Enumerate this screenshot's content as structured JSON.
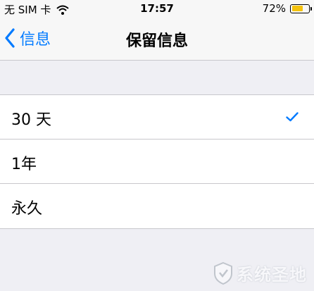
{
  "status_bar": {
    "carrier": "无 SIM 卡",
    "time": "17:57",
    "battery_percent": "72%",
    "battery_level": 0.72,
    "battery_color": "#f4c20d"
  },
  "nav": {
    "back_label": "信息",
    "title": "保留信息",
    "accent": "#007aff"
  },
  "options": [
    {
      "label": "30 天",
      "selected": true
    },
    {
      "label": "1年",
      "selected": false
    },
    {
      "label": "永久",
      "selected": false
    }
  ],
  "watermark": {
    "text": "系统圣地"
  }
}
